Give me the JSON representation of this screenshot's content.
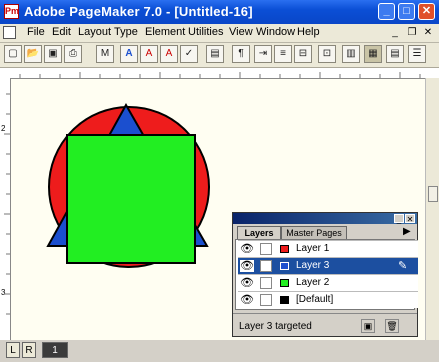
{
  "window": {
    "title": "Adobe PageMaker 7.0 - [Untitled-16]",
    "app_icon": "pagemaker-icon",
    "minimize_glyph": "_",
    "maximize_glyph": "□",
    "close_glyph": "✕"
  },
  "menubar": {
    "items": [
      "File",
      "Edit",
      "Layout",
      "Type",
      "Element",
      "Utilities",
      "View",
      "Window",
      "Help"
    ],
    "mdi_minimize": "_",
    "mdi_restore": "❐",
    "mdi_close": "✕"
  },
  "toolbar": {
    "buttons": [
      {
        "icon": "new-document-icon",
        "glyph": "▢"
      },
      {
        "icon": "open-icon",
        "glyph": "📂"
      },
      {
        "icon": "save-icon",
        "glyph": "▣"
      },
      {
        "icon": "print-icon",
        "glyph": "⎙"
      },
      {
        "icon": "find-icon",
        "glyph": "M"
      },
      {
        "icon": "spelling-icon",
        "glyph": "A"
      },
      {
        "icon": "font-icon",
        "glyph": "A"
      },
      {
        "icon": "character-icon",
        "glyph": "A"
      },
      {
        "icon": "text-style-icon",
        "glyph": "✓"
      },
      {
        "icon": "image-icon",
        "glyph": "▤"
      },
      {
        "icon": "paragraph-icon",
        "glyph": "¶"
      },
      {
        "icon": "indent-tabs-icon",
        "glyph": "⇥"
      },
      {
        "icon": "hyphenation-icon",
        "glyph": "≡"
      },
      {
        "icon": "align-icon",
        "glyph": "⊟"
      },
      {
        "icon": "frame-icon",
        "glyph": "⊡"
      },
      {
        "icon": "group-icon",
        "glyph": "▥"
      },
      {
        "icon": "colors-icon",
        "glyph": "▦"
      },
      {
        "icon": "layers-icon",
        "glyph": "▤"
      },
      {
        "icon": "styles-icon",
        "glyph": "☰"
      }
    ]
  },
  "rulers": {
    "left_marks": [
      "2",
      "3"
    ]
  },
  "colors": {
    "circle": "#ee1c1c",
    "triangle": "#1b4fcf",
    "square": "#22ee22",
    "selection": "#1c4fa0"
  },
  "pages": {
    "left_label": "L",
    "right_label": "R",
    "current_page": "1"
  },
  "layers_palette": {
    "tabs": [
      "Layers",
      "Master Pages"
    ],
    "menu_arrow": "▶",
    "close_glyph": "✕",
    "minimize_glyph": "_",
    "layers": [
      {
        "name": "Layer 1",
        "color": "#ee1c1c",
        "visible": true,
        "selected": false
      },
      {
        "name": "Layer 3",
        "color": "#1b4fcf",
        "visible": true,
        "selected": true
      },
      {
        "name": "Layer 2",
        "color": "#22ee22",
        "visible": true,
        "selected": false
      },
      {
        "name": "[Default]",
        "color": "#000000",
        "visible": true,
        "selected": false
      }
    ],
    "status": "Layer 3 targeted",
    "new_layer_icon": "new-layer-icon",
    "delete_layer_icon": "trash-icon"
  }
}
